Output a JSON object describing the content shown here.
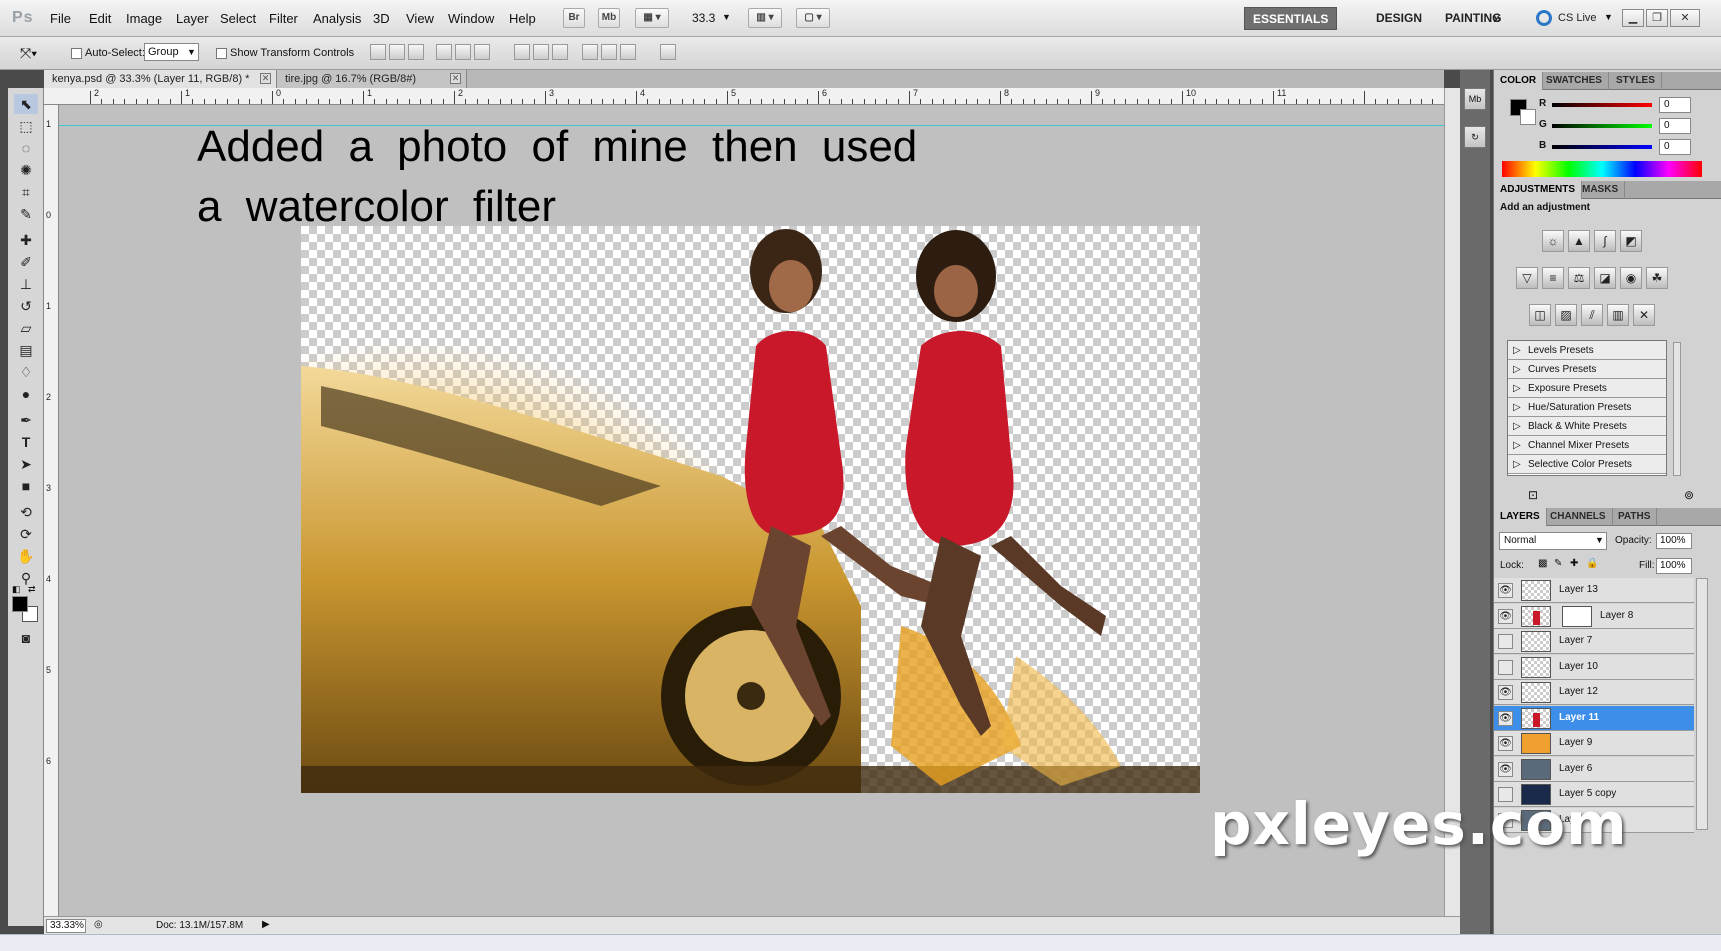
{
  "menubar": {
    "logo": "Ps",
    "items": [
      "File",
      "Edit",
      "Image",
      "Layer",
      "Select",
      "Filter",
      "Analysis",
      "3D",
      "View",
      "Window",
      "Help"
    ],
    "bridge_btn": "Br",
    "minibridge_btn": "Mb",
    "zoom_value": "33.3",
    "workspaces": [
      "ESSENTIALS",
      "DESIGN",
      "PAINTING"
    ],
    "more": "»",
    "cs_live": "CS Live"
  },
  "options": {
    "auto_select_label": "Auto-Select:",
    "auto_select_value": "Group",
    "show_transform_label": "Show Transform Controls"
  },
  "tabs": [
    {
      "label": "kenya.psd @ 33.3% (Layer 11, RGB/8) *"
    },
    {
      "label": "tire.jpg @ 16.7% (RGB/8#)"
    }
  ],
  "ruler": {
    "top": [
      "2",
      "1",
      "0",
      "1",
      "2",
      "3",
      "4",
      "5",
      "6",
      "7",
      "8",
      "9",
      "10",
      "11"
    ],
    "left": [
      "1",
      "0",
      "1",
      "2",
      "3",
      "4",
      "5",
      "6"
    ]
  },
  "canvas": {
    "caption": "Added a photo of mine then used a watercolor filter"
  },
  "status": {
    "zoom": "33.33%",
    "doc": "Doc: 13.1M/157.8M"
  },
  "color_panel": {
    "tabs": [
      "COLOR",
      "SWATCHES",
      "STYLES"
    ],
    "channels": [
      {
        "label": "R",
        "value": "0",
        "color": "#e00000"
      },
      {
        "label": "G",
        "value": "0",
        "color": "#00c000"
      },
      {
        "label": "B",
        "value": "0",
        "color": "#0000e0"
      }
    ]
  },
  "adjustments_panel": {
    "tabs": [
      "ADJUSTMENTS",
      "MASKS"
    ],
    "heading": "Add an adjustment",
    "presets": [
      "Levels Presets",
      "Curves Presets",
      "Exposure Presets",
      "Hue/Saturation Presets",
      "Black & White Presets",
      "Channel Mixer Presets",
      "Selective Color Presets"
    ]
  },
  "layers_panel": {
    "tabs": [
      "LAYERS",
      "CHANNELS",
      "PATHS"
    ],
    "blend_mode": "Normal",
    "opacity_label": "Opacity:",
    "opacity": "100%",
    "lock_label": "Lock:",
    "fill_label": "Fill:",
    "fill": "100%",
    "layers": [
      {
        "name": "Layer 13",
        "visible": true,
        "selected": false,
        "thumb": "transparent"
      },
      {
        "name": "Layer 8",
        "visible": true,
        "selected": false,
        "thumb": "figure"
      },
      {
        "name": "Layer 7",
        "visible": false,
        "selected": false,
        "thumb": "transparent"
      },
      {
        "name": "Layer 10",
        "visible": false,
        "selected": false,
        "thumb": "transparent"
      },
      {
        "name": "Layer 12",
        "visible": true,
        "selected": false,
        "thumb": "transparent"
      },
      {
        "name": "Layer 11",
        "visible": true,
        "selected": true,
        "thumb": "figure"
      },
      {
        "name": "Layer 9",
        "visible": true,
        "selected": false,
        "thumb": "orange"
      },
      {
        "name": "Layer 6",
        "visible": true,
        "selected": false,
        "thumb": "car"
      },
      {
        "name": "Layer 5 copy",
        "visible": false,
        "selected": false,
        "thumb": "dark"
      },
      {
        "name": "Layer",
        "visible": false,
        "selected": false,
        "thumb": "car"
      }
    ]
  },
  "watermark": "pxleyes.com"
}
